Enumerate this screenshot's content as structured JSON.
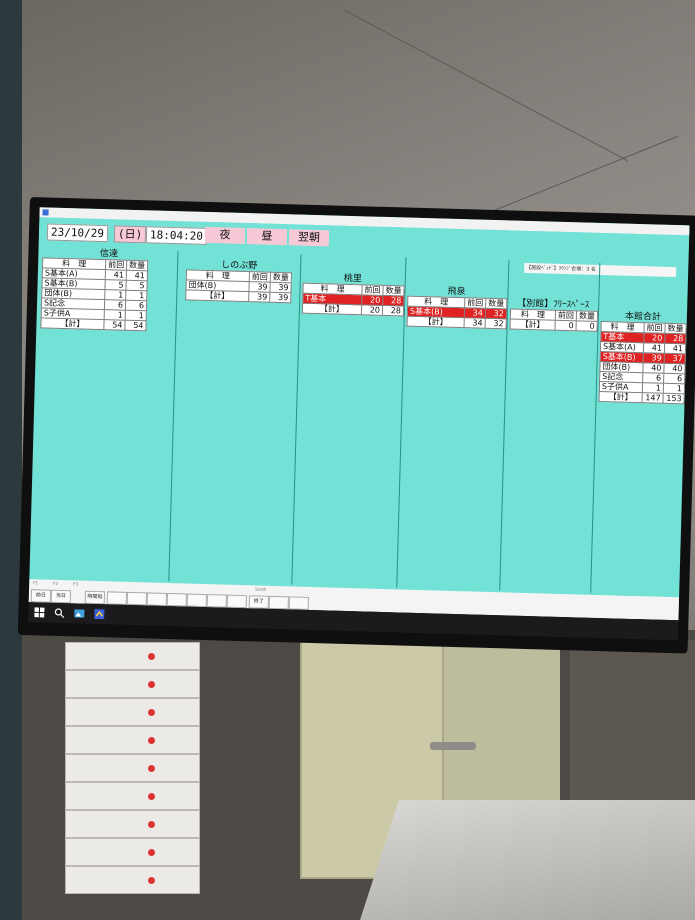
{
  "header": {
    "date": "23/10/29",
    "weekday": "(日)",
    "time": "18:04:20",
    "shifts": [
      "夜",
      "昼",
      "翌朝"
    ]
  },
  "notice": "【施設ﾍﾞｯﾄﾞ】ﾗｳﾝｼﾞ会場：3 名",
  "function_keys": [
    "前日",
    "当日",
    "時間指",
    "終了"
  ],
  "columns": [
    {
      "title": "信達",
      "headers": [
        "料　理",
        "前回",
        "数量"
      ],
      "rows": [
        {
          "name": "S基本(A)",
          "prev": "41",
          "qty": "41",
          "hl": false
        },
        {
          "name": "S基本(B)",
          "prev": "5",
          "qty": "5",
          "hl": false
        },
        {
          "name": "団体(B)",
          "prev": "1",
          "qty": "1",
          "hl": false
        },
        {
          "name": "S記念",
          "prev": "6",
          "qty": "6",
          "hl": false
        },
        {
          "name": "S子供A",
          "prev": "1",
          "qty": "1",
          "hl": false
        }
      ],
      "total": {
        "label": "【計】",
        "prev": "54",
        "qty": "54"
      }
    },
    {
      "title": "しのぶ野",
      "headers": [
        "料　理",
        "前回",
        "数量"
      ],
      "rows": [
        {
          "name": "団体(B)",
          "prev": "39",
          "qty": "39",
          "hl": false
        }
      ],
      "total": {
        "label": "【計】",
        "prev": "39",
        "qty": "39"
      }
    },
    {
      "title": "桃里",
      "headers": [
        "料　理",
        "前回",
        "数量"
      ],
      "rows": [
        {
          "name": "T基本",
          "prev": "20",
          "qty": "28",
          "hl": true
        }
      ],
      "total": {
        "label": "【計】",
        "prev": "20",
        "qty": "28"
      }
    },
    {
      "title": "飛泉",
      "headers": [
        "料　理",
        "前回",
        "数量"
      ],
      "rows": [
        {
          "name": "S基本(B)",
          "prev": "34",
          "qty": "32",
          "hl": true
        }
      ],
      "total": {
        "label": "【計】",
        "prev": "34",
        "qty": "32"
      }
    },
    {
      "title": "【別館】ﾌﾘｰｽﾍﾟｰｽ",
      "headers": [
        "料　理",
        "前回",
        "数量"
      ],
      "rows": [],
      "total": {
        "label": "【計】",
        "prev": "0",
        "qty": "0"
      }
    },
    {
      "title": "本館合計",
      "headers": [
        "料　理",
        "前回",
        "数量"
      ],
      "rows": [
        {
          "name": "T基本",
          "prev": "20",
          "qty": "28",
          "hl": true
        },
        {
          "name": "S基本(A)",
          "prev": "41",
          "qty": "41",
          "hl": false
        },
        {
          "name": "S基本(B)",
          "prev": "39",
          "qty": "37",
          "hl": true
        },
        {
          "name": "団体(B)",
          "prev": "40",
          "qty": "40",
          "hl": false
        },
        {
          "name": "S記念",
          "prev": "6",
          "qty": "6",
          "hl": false
        },
        {
          "name": "S子供A",
          "prev": "1",
          "qty": "1",
          "hl": false
        }
      ],
      "total": {
        "label": "【計】",
        "prev": "147",
        "qty": "153"
      }
    }
  ]
}
